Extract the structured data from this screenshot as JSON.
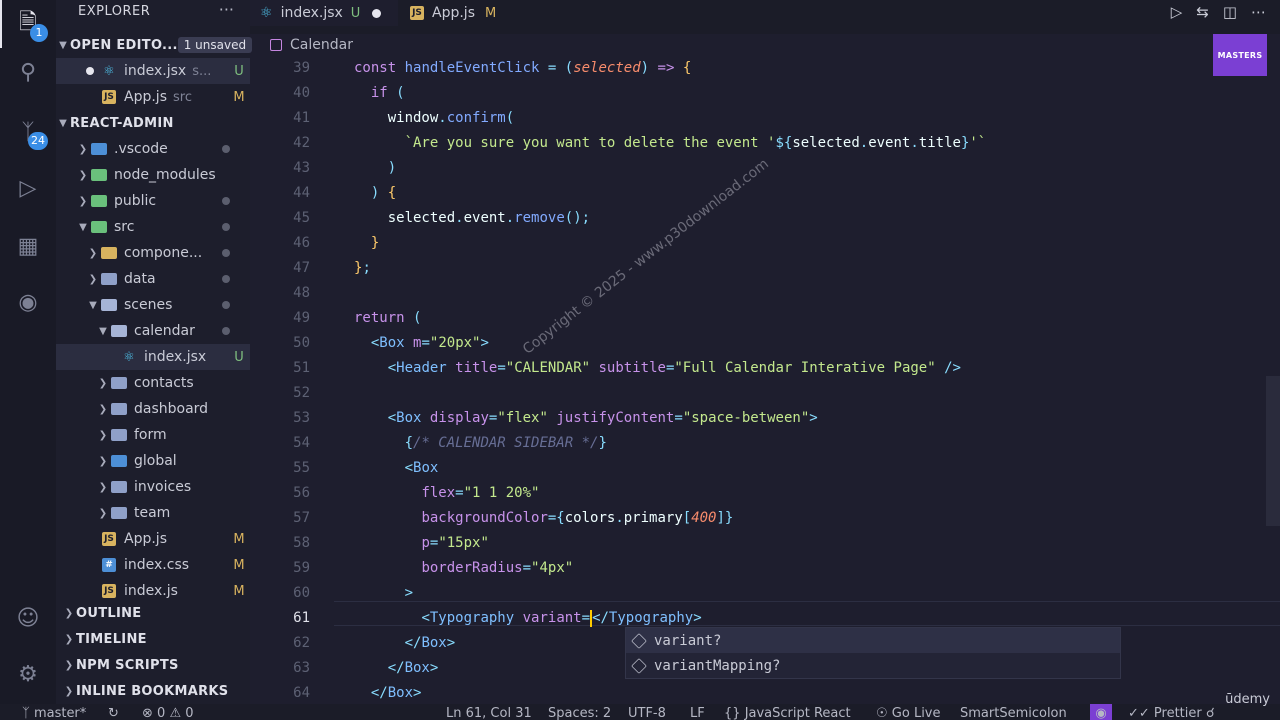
{
  "activity": {
    "scm_badge": "24",
    "explorer_badge": "1"
  },
  "sidebar": {
    "title": "EXPLORER",
    "more": "···",
    "open_editors": {
      "label": "OPEN EDITO...",
      "unsaved": "1 unsaved",
      "files": [
        {
          "name": "index.jsx",
          "dir": "s...",
          "status": "U"
        },
        {
          "name": "App.js",
          "dir": "src",
          "status": "M"
        }
      ]
    },
    "project": {
      "label": "REACT-ADMIN",
      "tree": [
        {
          "label": ".vscode"
        },
        {
          "label": "node_modules"
        },
        {
          "label": "public"
        },
        {
          "label": "src"
        },
        {
          "label": "compone..."
        },
        {
          "label": "data"
        },
        {
          "label": "scenes"
        },
        {
          "label": "calendar"
        },
        {
          "label": "index.jsx",
          "status": "U"
        },
        {
          "label": "contacts"
        },
        {
          "label": "dashboard"
        },
        {
          "label": "form"
        },
        {
          "label": "global"
        },
        {
          "label": "invoices"
        },
        {
          "label": "team"
        },
        {
          "label": "App.js",
          "status": "M"
        },
        {
          "label": "index.css",
          "status": "M"
        },
        {
          "label": "index.js",
          "status": "M"
        }
      ]
    },
    "sections": [
      "OUTLINE",
      "TIMELINE",
      "NPM SCRIPTS",
      "INLINE BOOKMARKS"
    ]
  },
  "tabs": [
    {
      "label": "index.jsx",
      "status": "U"
    },
    {
      "label": "App.js",
      "status": "M"
    }
  ],
  "breadcrumb": "Calendar",
  "badge_logo": "MASTERS",
  "editor": {
    "line_numbers": [
      "39",
      "40",
      "41",
      "42",
      "43",
      "44",
      "45",
      "46",
      "47",
      "48",
      "49",
      "50",
      "51",
      "52",
      "53",
      "54",
      "55",
      "56",
      "57",
      "58",
      "59",
      "60",
      "61",
      "62",
      "63",
      "64"
    ],
    "current_line": "61"
  },
  "suggest": [
    "variant?",
    "variantMapping?"
  ],
  "watermark": "Copyright © 2025 - www.p30download.com",
  "statusbar": {
    "branch": "master*",
    "errors": "0",
    "warnings": "0",
    "position": "Ln 61, Col 31",
    "spaces": "Spaces: 2",
    "encoding": "UTF-8",
    "eol": "LF",
    "language": "JavaScript React",
    "golive": "Go Live",
    "smartsemicolon": "SmartSemicolon",
    "prettier": "Prettier"
  },
  "udemy": "ūdemy"
}
